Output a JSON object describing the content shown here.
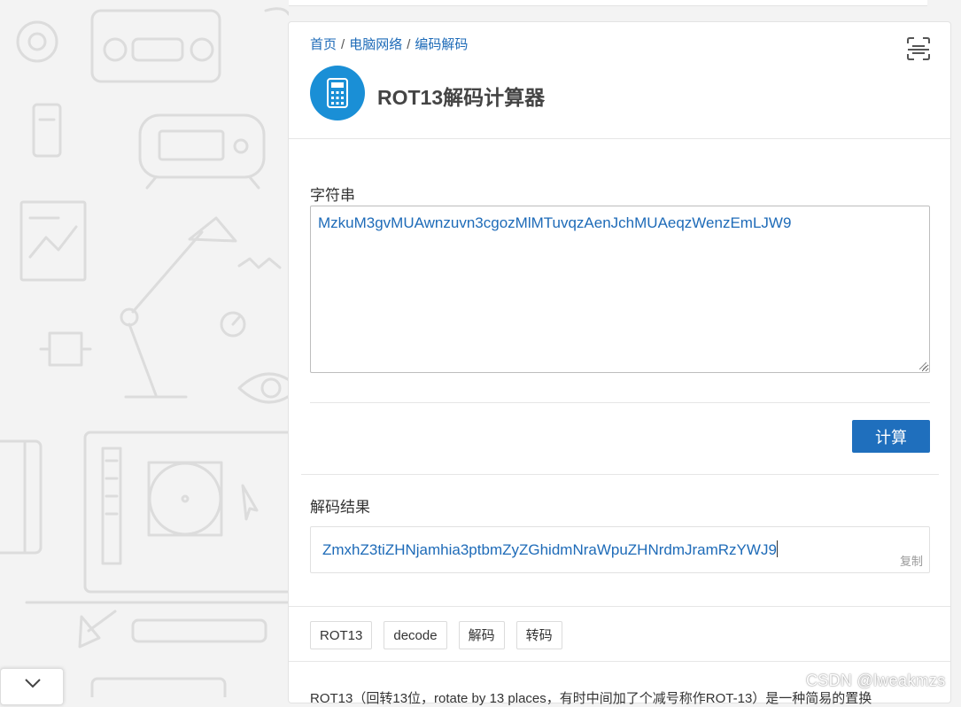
{
  "breadcrumb": {
    "home": "首页",
    "category": "电脑网络",
    "subcategory": "编码解码",
    "separator": "/"
  },
  "header": {
    "title": "ROT13解码计算器",
    "logo_icon": "calculator-icon",
    "scan_icon": "scan-icon"
  },
  "input": {
    "label": "字符串",
    "value": "MzkuM3gvMUAwnzuvn3cgozMlMTuvqzAenJchMUAeqzWenzEmLJW9"
  },
  "actions": {
    "calculate_label": "计算"
  },
  "result": {
    "label": "解码结果",
    "value": "ZmxhZ3tiZHNjamhia3ptbmZyZGhidmNraWpuZHNrdmJramRzYWJ9",
    "copy_label": "复制"
  },
  "tags": [
    "ROT13",
    "decode",
    "解码",
    "转码"
  ],
  "description": "ROT13（回转13位，rotate by 13 places，有时中间加了个减号称作ROT-13）是一种简易的置换",
  "watermark": "CSDN @lweakmzs",
  "colors": {
    "link": "#1e6bb8",
    "primary_button": "#1f6fbd",
    "logo_circle": "#1a8fd6"
  }
}
